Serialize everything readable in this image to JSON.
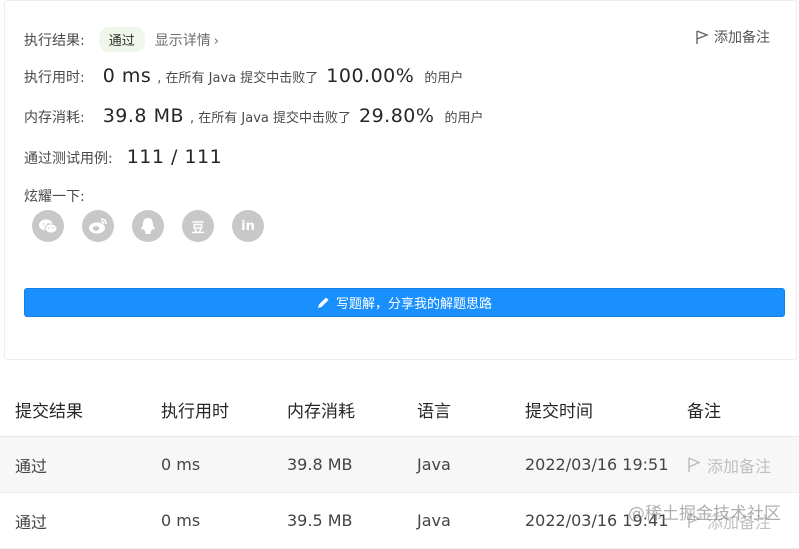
{
  "result": {
    "label": "执行结果:",
    "status": "通过",
    "detail_link": "显示详情",
    "add_note": "添加备注"
  },
  "runtime": {
    "label": "执行用时:",
    "value": "0 ms",
    "mid": ", 在所有 Java 提交中击败了",
    "percent": "100.00%",
    "suffix": "的用户"
  },
  "memory": {
    "label": "内存消耗:",
    "value": "39.8 MB",
    "mid": ", 在所有 Java 提交中击败了",
    "percent": "29.80%",
    "suffix": "的用户"
  },
  "tests": {
    "label": "通过测试用例:",
    "value": "111 / 111"
  },
  "share": {
    "label": "炫耀一下:",
    "items": [
      "wechat-icon",
      "weibo-icon",
      "qq-icon",
      "douban-icon",
      "linkedin-icon"
    ],
    "douban_glyph": "豆",
    "linkedin_glyph": "in"
  },
  "write_button": "写题解，分享我的解题思路",
  "table": {
    "headers": [
      "提交结果",
      "执行用时",
      "内存消耗",
      "语言",
      "提交时间",
      "备注"
    ],
    "rows": [
      {
        "status": "通过",
        "time": "0 ms",
        "memory": "39.8 MB",
        "lang": "Java",
        "date": "2022/03/16 19:51",
        "note": "添加备注"
      },
      {
        "status": "通过",
        "time": "0 ms",
        "memory": "39.5 MB",
        "lang": "Java",
        "date": "2022/03/16 19:41",
        "note": "添加备注"
      }
    ]
  },
  "watermark": "@稀土掘金技术社区",
  "colors": {
    "accent": "#1a90ff",
    "success": "#5cb85c",
    "badge_bg": "#eef7ea"
  }
}
